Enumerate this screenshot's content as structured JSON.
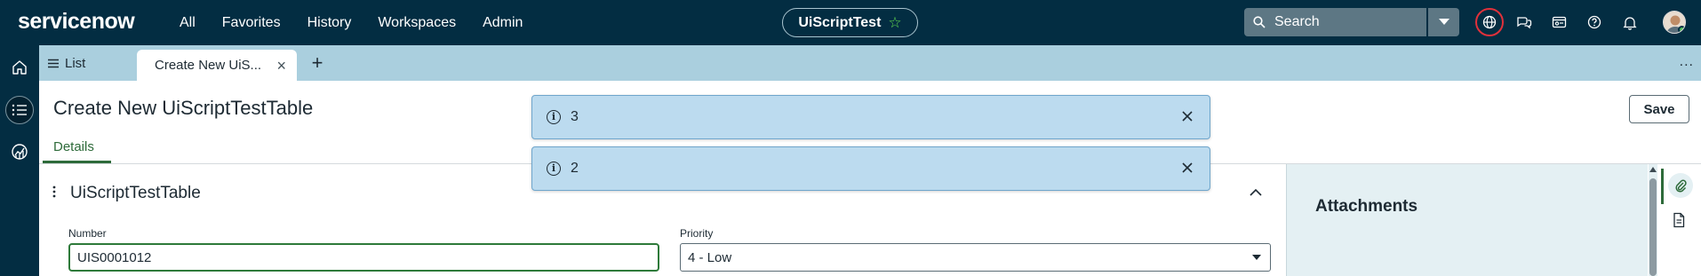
{
  "header": {
    "logo": "servicenow",
    "nav": [
      "All",
      "Favorites",
      "History",
      "Workspaces",
      "Admin"
    ],
    "scope_name": "UiScriptTest",
    "scope_star_icon": "star-icon",
    "search_placeholder": "Search",
    "icons": [
      "globe-icon",
      "chat-icon",
      "workspace-card-icon",
      "help-icon",
      "bell-icon"
    ]
  },
  "rail": {
    "icons": [
      "home-icon",
      "list-icon",
      "analytics-icon"
    ],
    "active": "list-icon"
  },
  "tabs": {
    "list_label": "List",
    "active_label": "Create New UiS...",
    "add_label": "+",
    "more_label": "..."
  },
  "form": {
    "title": "Create New UiScriptTestTable",
    "save_label": "Save",
    "subtab": "Details",
    "section_title": "UiScriptTestTable",
    "number_label": "Number",
    "number_value": "UIS0001012",
    "priority_label": "Priority",
    "priority_value": "4 - Low"
  },
  "notifications": [
    {
      "message": "3"
    },
    {
      "message": "2"
    }
  ],
  "attachments": {
    "title": "Attachments"
  },
  "colors": {
    "header_bg": "#032d42",
    "tabstrip_bg": "#aacfde",
    "accent_green": "#2e6b3a",
    "notification_bg": "#bcdbef",
    "attention_ring": "#e0313b"
  }
}
